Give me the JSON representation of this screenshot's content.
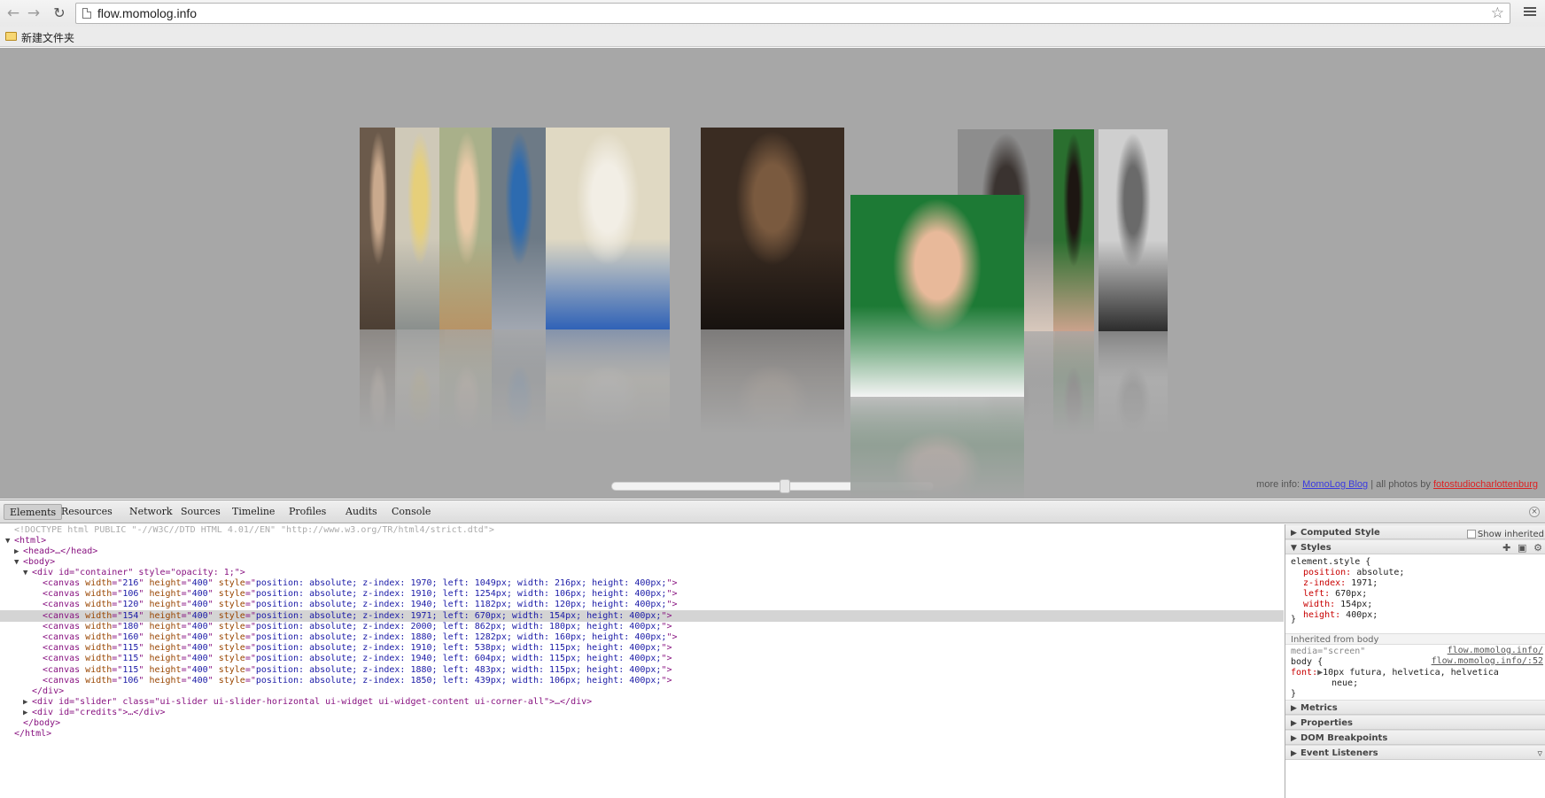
{
  "browser": {
    "url": "flow.momolog.info",
    "bookmark_folder": "新建文件夹",
    "back_icon": "back-arrow-icon",
    "forward_icon": "forward-arrow-icon",
    "reload_icon": "reload-icon",
    "star_icon": "star-icon",
    "menu_icon": "hamburger-menu-icon"
  },
  "page": {
    "background": "#a7a7a7",
    "photos": [
      {
        "name": "portrait-woman-face-edge",
        "colors": [
          "#6b5a4b",
          "#c9a98d",
          "#4c3f34"
        ]
      },
      {
        "name": "portrait-woman-sitting-yellow",
        "colors": [
          "#cfc9b8",
          "#e6cf7a",
          "#8a8f8d"
        ]
      },
      {
        "name": "portrait-woman-smiling",
        "colors": [
          "#a9b08a",
          "#e8c9a7",
          "#b79467"
        ]
      },
      {
        "name": "portrait-woman-blue-pants",
        "colors": [
          "#6d7a86",
          "#2d6bb0",
          "#a1a7b1"
        ]
      },
      {
        "name": "portrait-woman-brick-wall",
        "colors": [
          "#e0d9c3",
          "#f2eee5",
          "#2f62b7"
        ]
      },
      {
        "name": "portrait-woman-stairs",
        "colors": [
          "#3a2c22",
          "#7a5a3f",
          "#17120f"
        ]
      },
      {
        "name": "portrait-man-green-background",
        "colors": [
          "#1d7a35",
          "#e8b99a",
          "#f4f4f4"
        ]
      },
      {
        "name": "portrait-woman-grey-background",
        "colors": [
          "#8d8d8d",
          "#3a3330",
          "#d8c8bc"
        ]
      },
      {
        "name": "portrait-woman-green-background",
        "colors": [
          "#2a6f2f",
          "#1d1612",
          "#caa28c"
        ]
      },
      {
        "name": "portrait-woman-black-white",
        "colors": [
          "#cfcfcf",
          "#6a6a6a",
          "#2c2c2c"
        ]
      }
    ],
    "slider_value": 0.54,
    "credits": {
      "more_info": "more info:",
      "blog_link": "MomoLog Blog",
      "separator": " |  ",
      "all_photos": "all photos by",
      "foto_link": "fotostudiocharlottenburg"
    }
  },
  "devtools": {
    "tabs": [
      {
        "label": "Elements",
        "active": true
      },
      {
        "label": "Resources",
        "active": false
      },
      {
        "label": "Network",
        "active": false
      },
      {
        "label": "Sources",
        "active": false
      },
      {
        "label": "Timeline",
        "active": false
      },
      {
        "label": "Profiles",
        "active": false
      },
      {
        "label": "Audits",
        "active": false
      },
      {
        "label": "Console",
        "active": false
      }
    ],
    "doctype": "<!DOCTYPE html PUBLIC \"-//W3C//DTD HTML 4.01//EN\" \"http://www.w3.org/TR/html4/strict.dtd\">",
    "html_open": "<html>",
    "head_collapsed": "<head>…</head>",
    "body_open": "<body>",
    "container_open": "<div id=\"container\" style=\"opacity: 1;\">",
    "canvases": [
      {
        "width": "216",
        "style": "position: absolute; z-index: 1970; left: 1049px; width: 216px; height: 400px;",
        "selected": false
      },
      {
        "width": "106",
        "style": "position: absolute; z-index: 1910; left: 1254px; width: 106px; height: 400px;",
        "selected": false
      },
      {
        "width": "120",
        "style": "position: absolute; z-index: 1940; left: 1182px; width: 120px; height: 400px;",
        "selected": false
      },
      {
        "width": "154",
        "style": "position: absolute; z-index: 1971; left: 670px; width: 154px; height: 400px;",
        "selected": true
      },
      {
        "width": "180",
        "style": "position: absolute; z-index: 2000; left: 862px; width: 180px; height: 400px;",
        "selected": false
      },
      {
        "width": "160",
        "style": "position: absolute; z-index: 1880; left: 1282px; width: 160px; height: 400px;",
        "selected": false
      },
      {
        "width": "115",
        "style": "position: absolute; z-index: 1910; left: 538px; width: 115px; height: 400px;",
        "selected": false
      },
      {
        "width": "115",
        "style": "position: absolute; z-index: 1940; left: 604px; width: 115px; height: 400px;",
        "selected": false
      },
      {
        "width": "115",
        "style": "position: absolute; z-index: 1880; left: 483px; width: 115px; height: 400px;",
        "selected": false
      },
      {
        "width": "106",
        "style": "position: absolute; z-index: 1850; left: 439px; width: 106px; height: 400px;",
        "selected": false
      }
    ],
    "canvas_height": "400",
    "div_close": "</div>",
    "slider_div": "<div id=\"slider\" class=\"ui-slider ui-slider-horizontal ui-widget ui-widget-content ui-corner-all\">…</div>",
    "credits_div": "<div id=\"credits\">…</div>",
    "body_close": "</body>",
    "html_close": "</html>",
    "sidebar": {
      "computed_style": "Computed Style",
      "show_inherited": "Show inherited",
      "styles": "Styles",
      "element_style": "element.style {",
      "props": [
        {
          "name": "position",
          "value": "absolute;"
        },
        {
          "name": "z-index",
          "value": "1971;"
        },
        {
          "name": "left",
          "value": "670px;"
        },
        {
          "name": "width",
          "value": "154px;"
        },
        {
          "name": "height",
          "value": "400px;"
        }
      ],
      "close_brace": "}",
      "inherited_from": "Inherited from body",
      "media_line": "media=\"screen\"",
      "media_src": "flow.momolog.info/",
      "body_rule": "body {",
      "body_src": "flow.momolog.info/:52",
      "font_prop": "font:",
      "font_value": "10px futura, helvetica, helvetica",
      "font_value_cont": "neue;",
      "metrics": "Metrics",
      "properties": "Properties",
      "dom_breakpoints": "DOM Breakpoints",
      "event_listeners": "Event Listeners"
    }
  }
}
